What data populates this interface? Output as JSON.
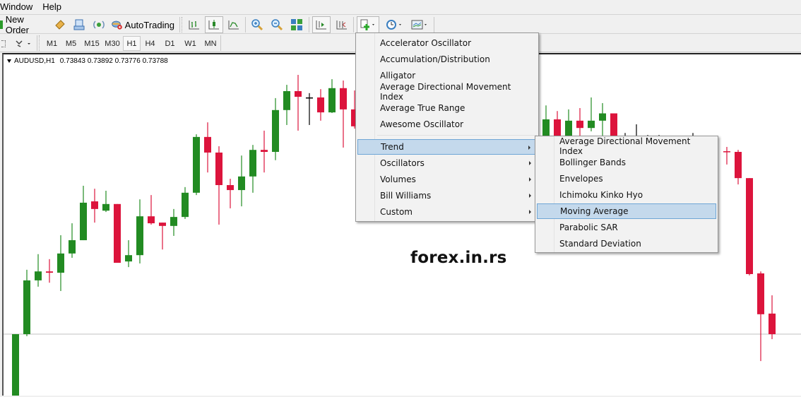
{
  "menubar": {
    "items": [
      "Window",
      "Help"
    ]
  },
  "toolbar": {
    "new_order_label": "New Order",
    "autotrading_label": "AutoTrading",
    "icons": [
      "new-order-icon",
      "market-watch-icon",
      "navigator-icon",
      "signal-icon",
      "autotrading-icon",
      "bar-chart-icon",
      "candlestick-icon",
      "line-chart-icon",
      "zoom-in-icon",
      "zoom-out-icon",
      "tile-windows-icon",
      "auto-scroll-icon",
      "chart-shift-icon",
      "indicators-icon",
      "periods-icon",
      "templates-icon"
    ]
  },
  "timeframes": {
    "items": [
      "M1",
      "M5",
      "M15",
      "M30",
      "H1",
      "H4",
      "D1",
      "W1",
      "MN"
    ],
    "active": "H1"
  },
  "chart": {
    "symbol_label": "AUDUSD,H1",
    "ohlc_label": "0.73843 0.73892 0.73776 0.73788",
    "watermark": "forex.in.rs",
    "colors": {
      "bull": "#228b22",
      "bear": "#dc143c",
      "doji": "#000000",
      "grid": "#c0c0c0"
    }
  },
  "chart_data": {
    "type": "candlestick",
    "title": "AUDUSD,H1",
    "note": "relative price levels on a 0-100 scale of visible chart height; no price axis is shown",
    "candles": [
      {
        "o": 0.0,
        "h": 18.5,
        "l": 0.0,
        "c": 18.5
      },
      {
        "o": 18.5,
        "h": 37.9,
        "l": 17.9,
        "c": 34.7
      },
      {
        "o": 34.7,
        "h": 42.6,
        "l": 32.8,
        "c": 37.4
      },
      {
        "o": 37.4,
        "h": 41.1,
        "l": 34.0,
        "c": 37.0
      },
      {
        "o": 37.0,
        "h": 48.3,
        "l": 31.5,
        "c": 42.8
      },
      {
        "o": 42.8,
        "h": 51.9,
        "l": 41.5,
        "c": 46.8
      },
      {
        "o": 46.8,
        "h": 63.2,
        "l": 46.8,
        "c": 58.1
      },
      {
        "o": 58.5,
        "h": 62.3,
        "l": 52.1,
        "c": 56.2
      },
      {
        "o": 55.7,
        "h": 61.7,
        "l": 55.3,
        "c": 57.7
      },
      {
        "o": 57.7,
        "h": 57.7,
        "l": 40.0,
        "c": 40.0
      },
      {
        "o": 40.4,
        "h": 46.8,
        "l": 38.7,
        "c": 42.3
      },
      {
        "o": 42.3,
        "h": 59.1,
        "l": 39.8,
        "c": 54.0
      },
      {
        "o": 54.0,
        "h": 60.4,
        "l": 51.5,
        "c": 51.9
      },
      {
        "o": 52.1,
        "h": 51.9,
        "l": 44.0,
        "c": 51.1
      },
      {
        "o": 51.1,
        "h": 56.2,
        "l": 48.1,
        "c": 53.8
      },
      {
        "o": 53.8,
        "h": 62.8,
        "l": 53.2,
        "c": 61.1
      },
      {
        "o": 61.1,
        "h": 78.7,
        "l": 60.4,
        "c": 77.9
      },
      {
        "o": 77.9,
        "h": 82.3,
        "l": 67.2,
        "c": 73.2
      },
      {
        "o": 73.2,
        "h": 75.1,
        "l": 51.5,
        "c": 63.4
      },
      {
        "o": 63.4,
        "h": 65.3,
        "l": 56.4,
        "c": 61.9
      },
      {
        "o": 61.9,
        "h": 72.3,
        "l": 57.0,
        "c": 66.0
      },
      {
        "o": 66.0,
        "h": 75.5,
        "l": 61.1,
        "c": 74.0
      },
      {
        "o": 74.0,
        "h": 79.8,
        "l": 67.2,
        "c": 73.4
      },
      {
        "o": 73.4,
        "h": 89.6,
        "l": 70.9,
        "c": 86.0
      },
      {
        "o": 86.0,
        "h": 93.6,
        "l": 81.5,
        "c": 91.7
      },
      {
        "o": 91.7,
        "h": 96.6,
        "l": 79.8,
        "c": 90.0
      },
      {
        "o": 89.8,
        "h": 91.1,
        "l": 81.5,
        "c": 89.8
      },
      {
        "o": 89.8,
        "h": 92.3,
        "l": 82.8,
        "c": 85.3
      },
      {
        "o": 85.3,
        "h": 95.3,
        "l": 85.1,
        "c": 92.6
      },
      {
        "o": 92.6,
        "h": 94.9,
        "l": 74.7,
        "c": 86.2
      },
      {
        "o": 86.2,
        "h": 91.9,
        "l": 80.4,
        "c": 81.1
      }
    ],
    "candles_right": [
      {
        "o": 78.3,
        "h": 87.4,
        "l": 78.3,
        "c": 83.2
      },
      {
        "o": 83.2,
        "h": 85.7,
        "l": 78.3,
        "c": 78.3
      },
      {
        "o": 78.3,
        "h": 86.2,
        "l": 78.3,
        "c": 82.8
      },
      {
        "o": 82.8,
        "h": 86.6,
        "l": 78.3,
        "c": 80.6
      },
      {
        "o": 80.6,
        "h": 89.8,
        "l": 79.6,
        "c": 82.8
      },
      {
        "o": 82.8,
        "h": 88.1,
        "l": 78.3,
        "c": 85.0
      },
      {
        "o": 85.0,
        "h": 85.0,
        "l": 78.3,
        "c": 78.3
      },
      {
        "o": 78.3,
        "h": 79.1,
        "l": 78.3,
        "c": 78.3
      },
      {
        "o": 78.3,
        "h": 81.7,
        "l": 78.3,
        "c": 78.3
      },
      {
        "o": 78.3,
        "h": 78.5,
        "l": 78.3,
        "c": 78.3
      },
      {
        "o": 78.3,
        "h": 78.5,
        "l": 78.3,
        "c": 78.3
      },
      {
        "o": 78.3,
        "h": 79.1,
        "l": 78.3,
        "c": 78.3
      },
      {
        "o": 73.6,
        "h": 74.9,
        "l": 69.6,
        "c": 73.4
      },
      {
        "o": 73.4,
        "h": 74.0,
        "l": 63.6,
        "c": 65.5
      },
      {
        "o": 65.5,
        "h": 65.5,
        "l": 36.2,
        "c": 36.6
      },
      {
        "o": 36.8,
        "h": 37.4,
        "l": 10.4,
        "c": 24.5
      },
      {
        "o": 24.7,
        "h": 30.2,
        "l": 17.0,
        "c": 18.5
      }
    ],
    "reference_line_level": 18.5
  },
  "indicators_menu": {
    "items": [
      {
        "label": "Accelerator Oscillator",
        "submenu": false
      },
      {
        "label": "Accumulation/Distribution",
        "submenu": false
      },
      {
        "label": "Alligator",
        "submenu": false
      },
      {
        "label": "Average Directional Movement Index",
        "submenu": false
      },
      {
        "label": "Average True Range",
        "submenu": false
      },
      {
        "label": "Awesome Oscillator",
        "submenu": false
      },
      {
        "label": "Trend",
        "submenu": true,
        "highlighted": true
      },
      {
        "label": "Oscillators",
        "submenu": true
      },
      {
        "label": "Volumes",
        "submenu": true
      },
      {
        "label": "Bill Williams",
        "submenu": true
      },
      {
        "label": "Custom",
        "submenu": true
      }
    ]
  },
  "trend_submenu": {
    "items": [
      {
        "label": "Average Directional Movement Index"
      },
      {
        "label": "Bollinger Bands"
      },
      {
        "label": "Envelopes"
      },
      {
        "label": "Ichimoku Kinko Hyo"
      },
      {
        "label": "Moving Average",
        "highlighted": true
      },
      {
        "label": "Parabolic SAR"
      },
      {
        "label": "Standard Deviation"
      }
    ]
  }
}
